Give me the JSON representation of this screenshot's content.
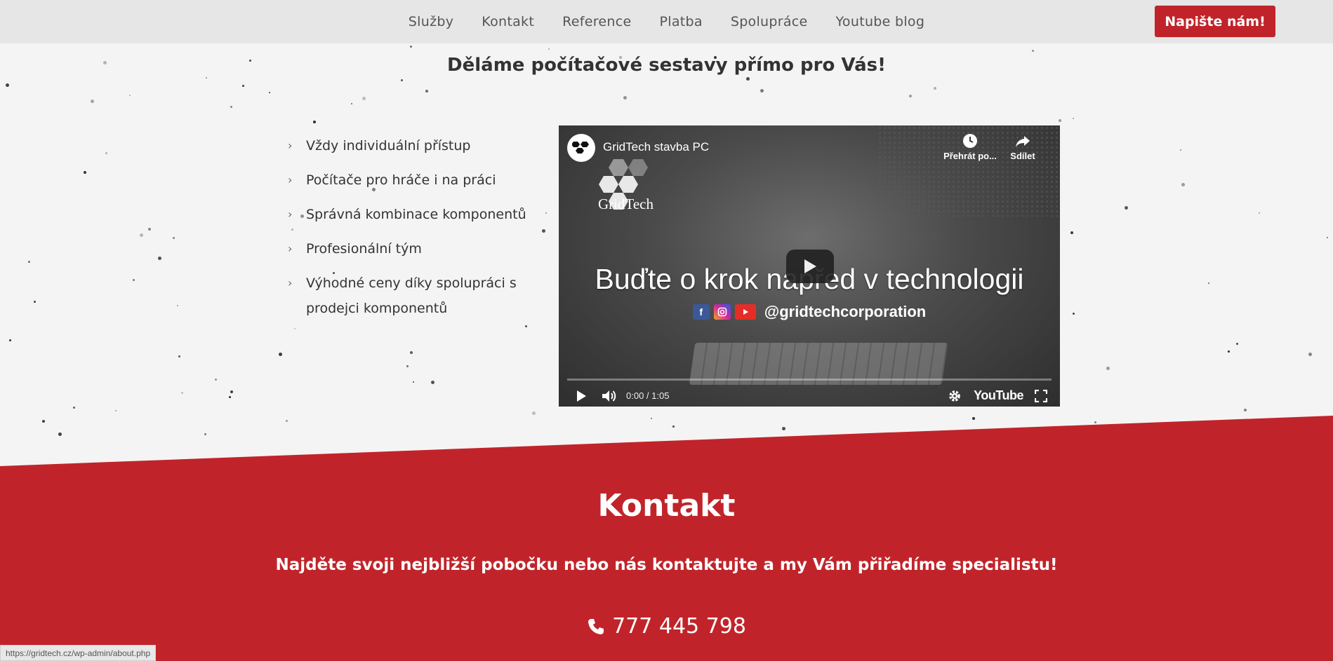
{
  "header": {
    "nav": [
      "Služby",
      "Kontakt",
      "Reference",
      "Platba",
      "Spolupráce",
      "Youtube blog"
    ],
    "cta_label": "Napište nám!"
  },
  "tagline": "Děláme počítačové sestavy přímo pro Vás!",
  "features": [
    "Vždy individuální přístup",
    "Počítače pro hráče i na práci",
    "Správná kombinace komponentů",
    "Profesionální tým",
    "Výhodné ceny díky spolupráci s prodejci komponentů"
  ],
  "video": {
    "title": "GridTech stavba PC",
    "brand": "GridTech",
    "watch_later": "Přehrát po...",
    "share": "Sdílet",
    "headline": "Buďte o krok napřed v technologii",
    "handle": "@gridtechcorporation",
    "time": "0:00 / 1:05",
    "youtube": "YouTube",
    "progress": 0
  },
  "contact": {
    "title": "Kontakt",
    "subtitle": "Najděte svoji nejbližší pobočku nebo nás kontaktujte a my Vám přiřadíme specialistu!",
    "phone": "777 445 798"
  },
  "status_url": "https://gridtech.cz/wp-admin/about.php",
  "colors": {
    "accent_red": "#c0242a",
    "header_bg": "#e6e6e6",
    "page_bg": "#f4f4f4"
  }
}
